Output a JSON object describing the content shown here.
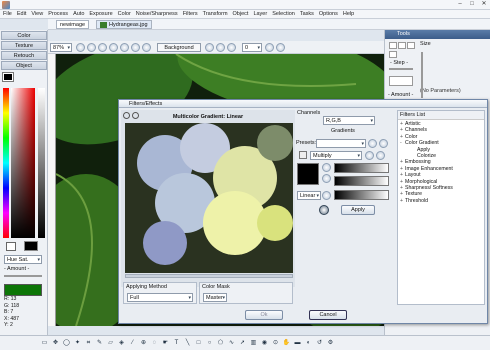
{
  "menu": [
    "File",
    "Edit",
    "View",
    "Process",
    "Auto",
    "Exposure",
    "Color",
    "Noise/Sharpness",
    "Filters",
    "Transform",
    "Object",
    "Layer",
    "Selection",
    "Tasks",
    "Options",
    "Help"
  ],
  "doc_tabs": [
    "newimage",
    "Hydrangeas.jpg"
  ],
  "zoom": "87%",
  "background_label": "Background",
  "opacity_value": "0",
  "left_tabs": [
    "Color",
    "Texture",
    "Retouch",
    "Object"
  ],
  "hue_sat": "Hue Sat.",
  "amount_label": "- Amount -",
  "pixel_info": [
    "R: 13",
    "G: 118",
    "B: 7",
    "X: 487",
    "Y: 2"
  ],
  "tools_panel": {
    "title": "Tools",
    "size_label": "Size",
    "step_label": "- Step -",
    "amount_label": "- Amount -",
    "no_params": "(No Parameters)"
  },
  "dialog": {
    "title": "Filters/Effects",
    "preview_title": "Multicolor Gradient: Linear",
    "channels_label": "Channels",
    "channels_value": "R,G,B",
    "gradients_label": "Gradients",
    "presets_label": "Presets:",
    "blend_value": "Multiply",
    "gradient_type": "Linear",
    "apply_label": "Apply",
    "applying_method_label": "Applying Method",
    "applying_method_value": "Full",
    "color_mask_label": "Color Mask",
    "color_mask_value": "Master",
    "ok_label": "Ok",
    "cancel_label": "Cancel",
    "filters_list_title": "Filters List",
    "filters": [
      {
        "label": "Artistic",
        "indent": 0,
        "sign": "+"
      },
      {
        "label": "Channels",
        "indent": 0,
        "sign": "+"
      },
      {
        "label": "Color",
        "indent": 0,
        "sign": "+"
      },
      {
        "label": "Color Gradient",
        "indent": 0,
        "sign": "-"
      },
      {
        "label": "Apply",
        "indent": 1,
        "sign": ""
      },
      {
        "label": "Colorize",
        "indent": 1,
        "sign": ""
      },
      {
        "label": "Embossing",
        "indent": 0,
        "sign": "+"
      },
      {
        "label": "Image Enhancement",
        "indent": 0,
        "sign": "+"
      },
      {
        "label": "Layout",
        "indent": 0,
        "sign": "+"
      },
      {
        "label": "Morphological",
        "indent": 0,
        "sign": "+"
      },
      {
        "label": "Sharpness/ Softness",
        "indent": 0,
        "sign": "+"
      },
      {
        "label": "Texture",
        "indent": 0,
        "sign": "+"
      },
      {
        "label": "Threshold",
        "indent": 0,
        "sign": "+"
      }
    ]
  },
  "colors": {
    "accent": "#3c5d8a",
    "swatch": "#0d7607"
  }
}
